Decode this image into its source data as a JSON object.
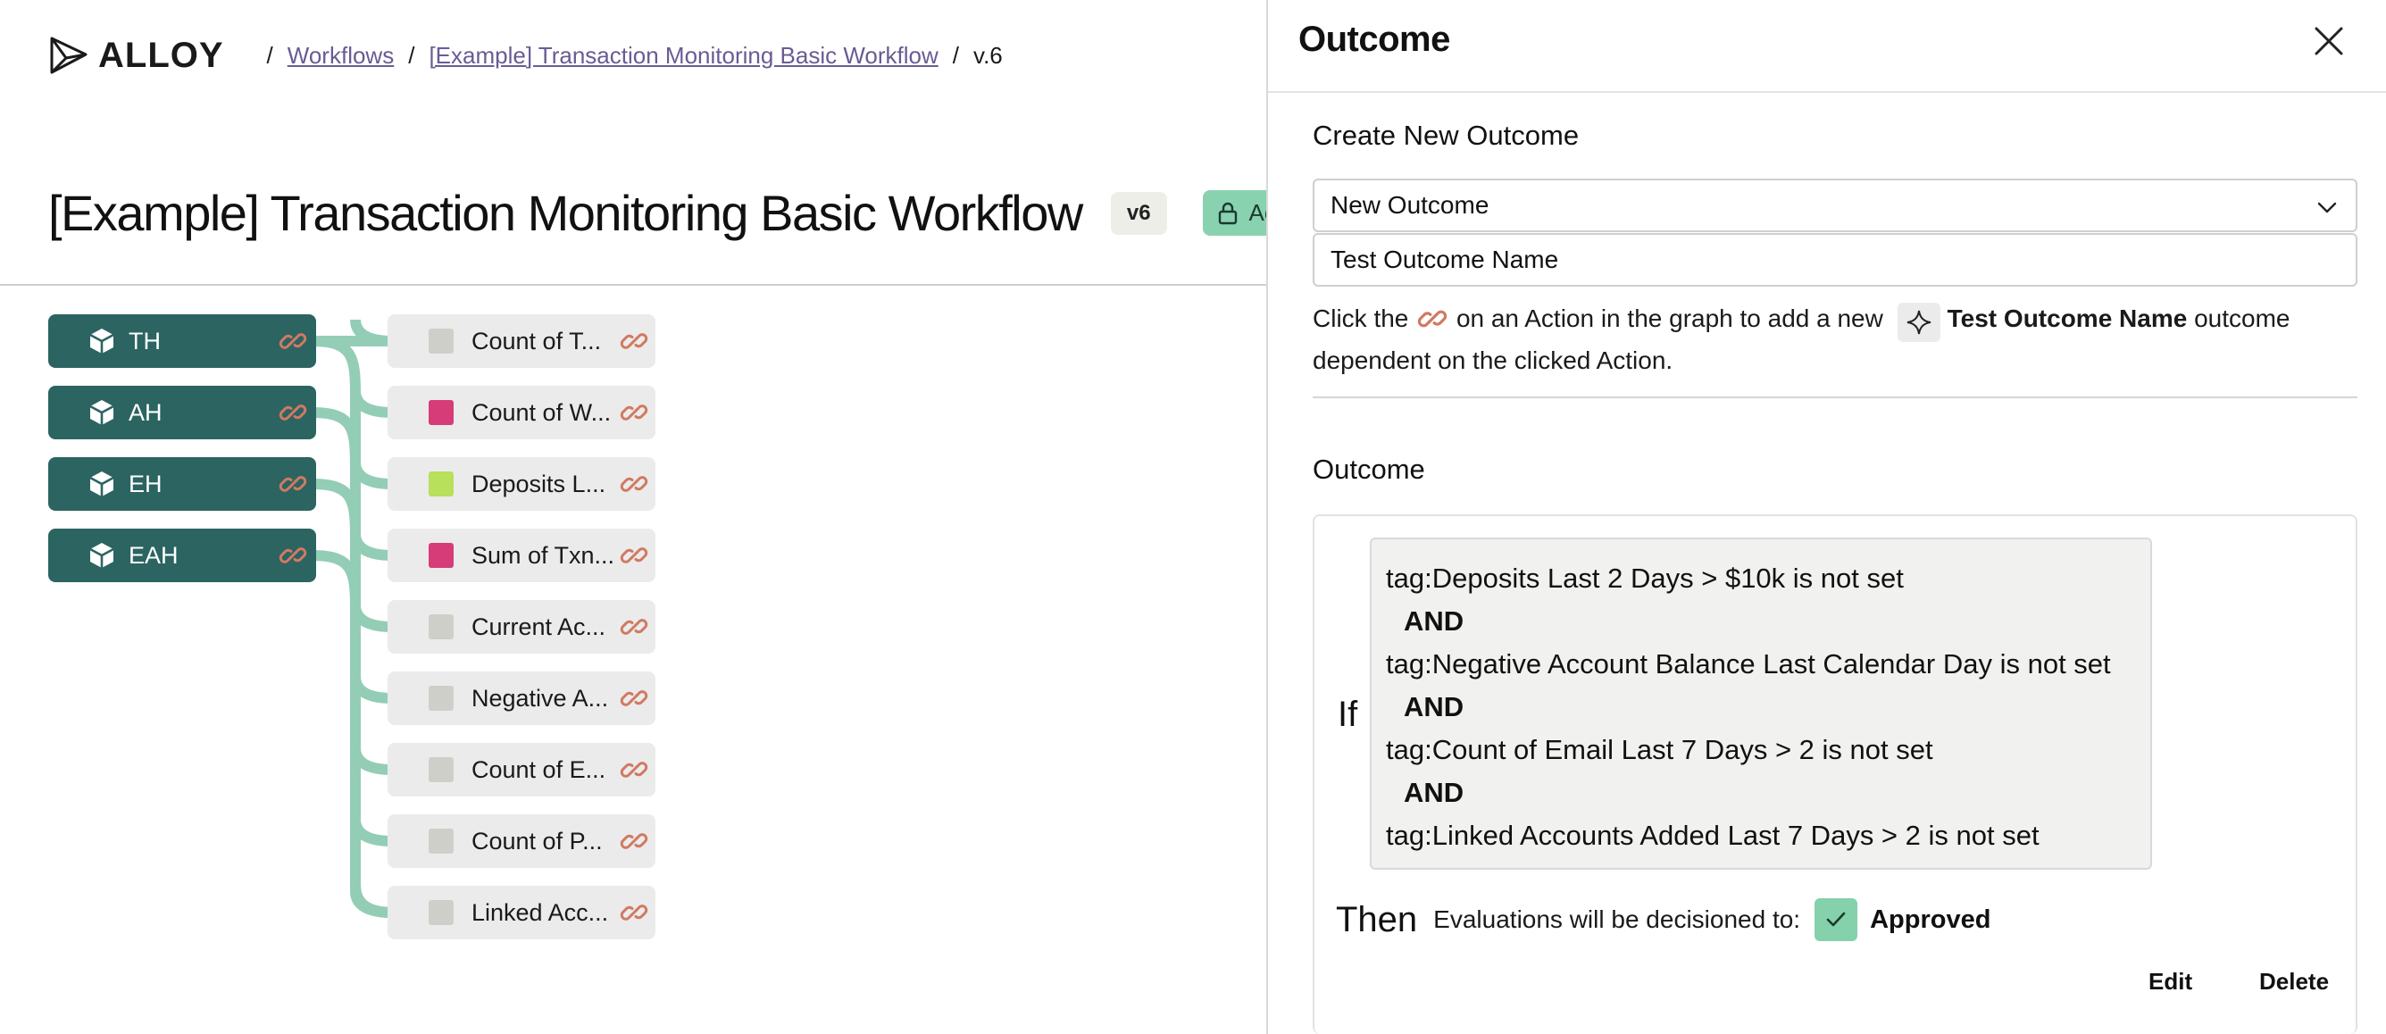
{
  "header": {
    "logo_text": "ALLOY",
    "breadcrumb": {
      "separator": "/",
      "workflows": "Workflows",
      "workflow_name": "[Example] Transaction Monitoring Basic Workflow",
      "version": "v.6"
    }
  },
  "page": {
    "title": "[Example] Transaction Monitoring Basic Workflow",
    "version_badge": "v6",
    "status_badge": "Ac"
  },
  "graph": {
    "connector_color": "#93cdb6",
    "source_color": "#2b6461",
    "link_icon_color": "#d07a62",
    "sources": [
      {
        "label": "TH"
      },
      {
        "label": "AH"
      },
      {
        "label": "EH"
      },
      {
        "label": "EAH"
      }
    ],
    "actions": [
      {
        "label": "Count of T...",
        "color": "#cfcfc9"
      },
      {
        "label": "Count of W...",
        "color": "#d63d78"
      },
      {
        "label": "Deposits L...",
        "color": "#b8e05a"
      },
      {
        "label": "Sum of Txn...",
        "color": "#d63d78"
      },
      {
        "label": "Current Ac...",
        "color": "#cfcfc9"
      },
      {
        "label": "Negative A...",
        "color": "#cfcfc9"
      },
      {
        "label": "Count of E...",
        "color": "#cfcfc9"
      },
      {
        "label": "Count of P...",
        "color": "#cfcfc9"
      },
      {
        "label": "Linked Acc...",
        "color": "#cfcfc9"
      }
    ]
  },
  "panel": {
    "title": "Outcome",
    "create_section_title": "Create New Outcome",
    "select_value": "New Outcome",
    "name_input_value": "Test Outcome Name",
    "help": {
      "part1": "Click the",
      "part2": "on an Action in the graph to add a new",
      "outcome_name": "Test Outcome Name",
      "part3": "outcome dependent on the clicked Action."
    },
    "outcome_section_title": "Outcome",
    "outcome": {
      "if_label": "If",
      "conditions": [
        "tag:Deposits Last 2 Days > $10k is not set",
        "tag:Negative Account Balance Last Calendar Day is not set",
        "tag:Count of Email Last 7 Days > 2 is not set",
        "tag:Linked Accounts Added Last 7 Days > 2 is not set"
      ],
      "joiner": "AND",
      "then_label": "Then",
      "then_text": "Evaluations will be decisioned to:",
      "decision": "Approved",
      "decision_color": "#84d1ac",
      "edit_label": "Edit",
      "delete_label": "Delete"
    }
  }
}
